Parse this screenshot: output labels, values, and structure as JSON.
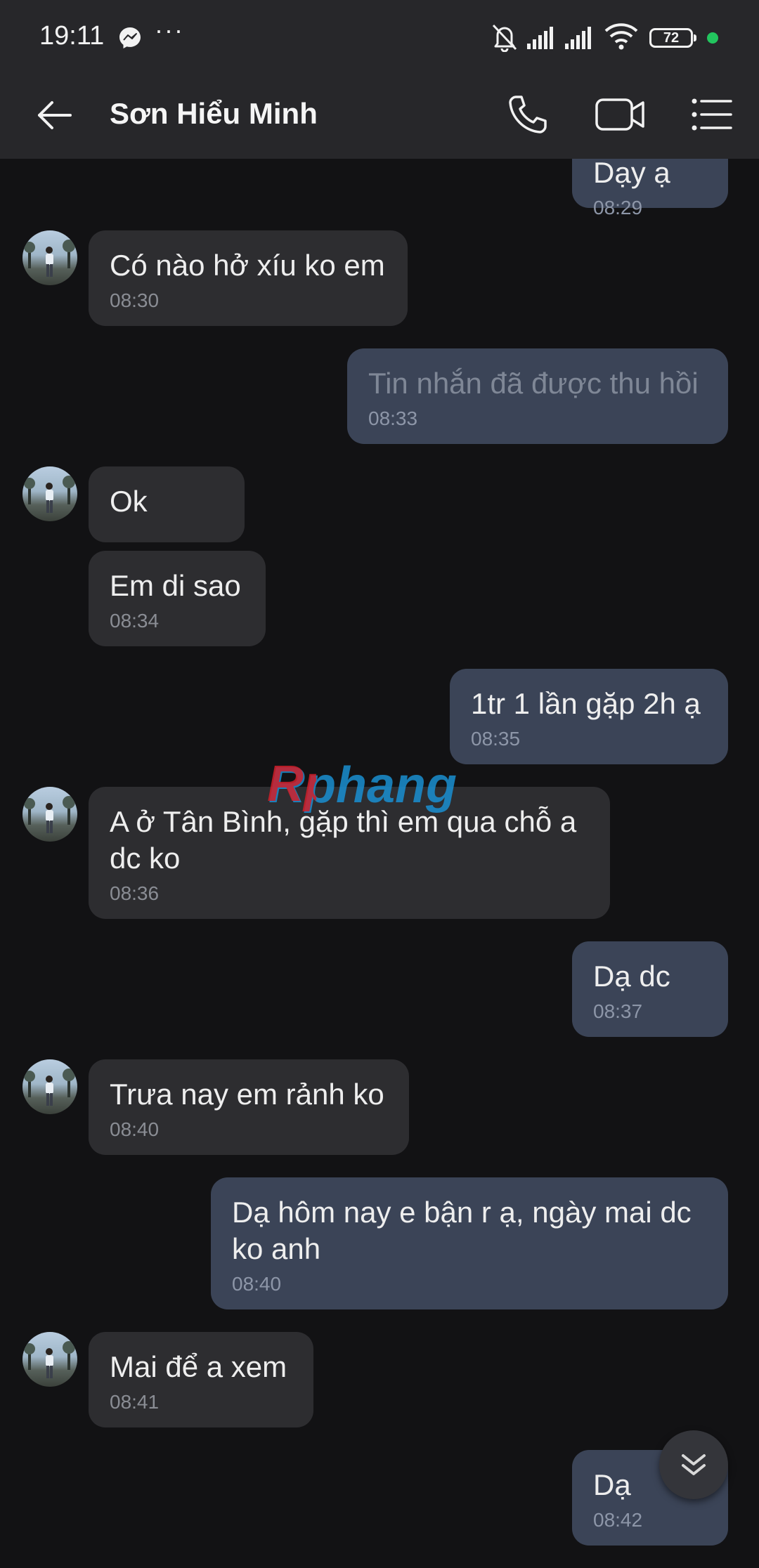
{
  "status_bar": {
    "time": "19:11",
    "more": "···",
    "battery": "72",
    "icons": [
      "messenger-icon",
      "mute-bell-icon",
      "signal-icon",
      "signal-icon",
      "wifi-icon",
      "battery-icon"
    ]
  },
  "header": {
    "contact_name": "Sơn Hiểu Minh",
    "icons": [
      "back-arrow-icon",
      "phone-icon",
      "video-call-icon",
      "menu-list-icon"
    ]
  },
  "watermark": "Rphang",
  "messages": [
    {
      "side": "out",
      "text": "Dạy ạ",
      "time": "08:29"
    },
    {
      "side": "in",
      "text": "Có nào hở xíu ko em",
      "time": "08:30"
    },
    {
      "side": "out",
      "text": "Tin nhắn đã được thu hồi",
      "time": "08:33",
      "recalled": true
    },
    {
      "side": "in",
      "text": "Ok",
      "time": ""
    },
    {
      "side": "in",
      "text": "Em di sao",
      "time": "08:34"
    },
    {
      "side": "out",
      "text": "1tr 1 lần gặp 2h ạ",
      "time": "08:35"
    },
    {
      "side": "in",
      "text": "A ở Tân Bình, gặp thì em qua chỗ a dc ko",
      "time": "08:36"
    },
    {
      "side": "out",
      "text": "Dạ dc",
      "time": "08:37"
    },
    {
      "side": "in",
      "text": "Trưa nay em rảnh ko",
      "time": "08:40"
    },
    {
      "side": "out",
      "text": "Dạ hôm nay e bận r ạ, ngày mai dc ko anh",
      "time": "08:40"
    },
    {
      "side": "in",
      "text": "Mai để a xem",
      "time": "08:41"
    },
    {
      "side": "out",
      "text": "Dạ",
      "time": "08:42"
    }
  ],
  "colors": {
    "background": "#121214",
    "header": "#27272a",
    "incoming_bubble": "#2d2d30",
    "outgoing_bubble": "#3b4457",
    "online_dot": "#22c55e"
  }
}
